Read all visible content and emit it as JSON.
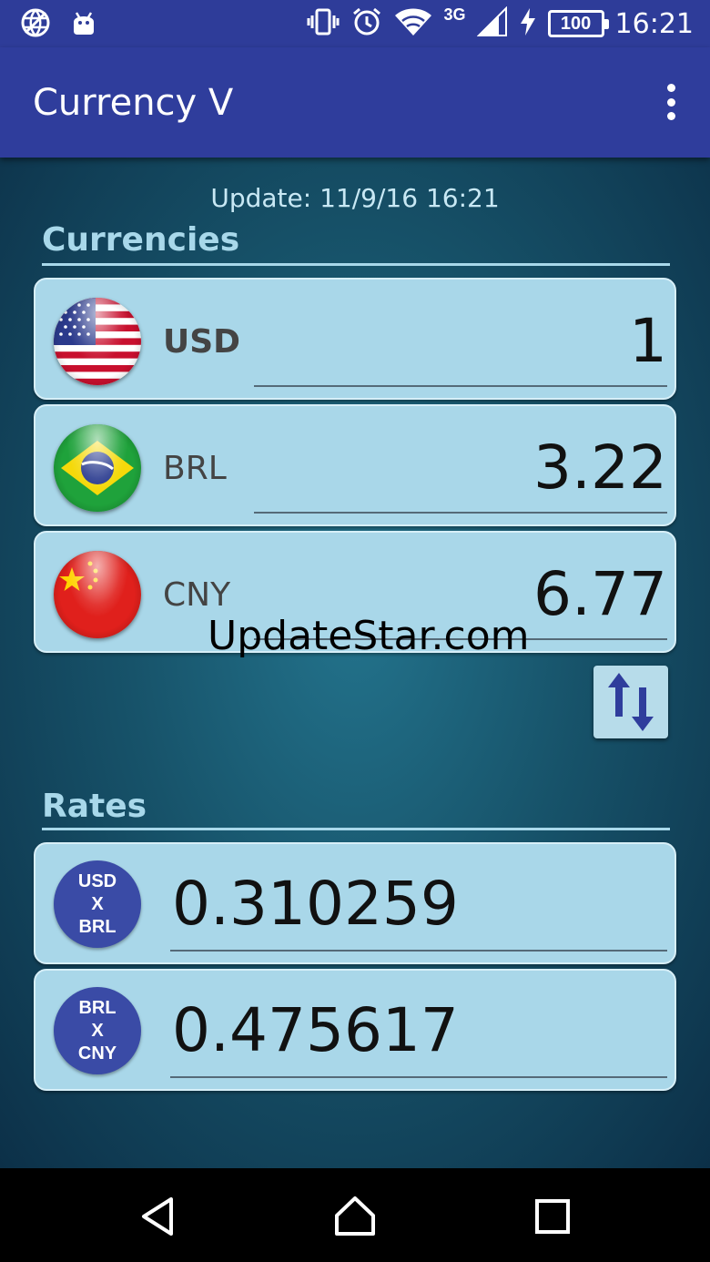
{
  "status_bar": {
    "network_type": "3G",
    "battery": "100",
    "time": "16:21"
  },
  "app_bar": {
    "title": "Currency V"
  },
  "update": {
    "text": "Update: 11/9/16 16:21"
  },
  "currencies": {
    "title": "Currencies",
    "items": [
      {
        "code": "USD",
        "value": "1",
        "flag": "us-flag-icon"
      },
      {
        "code": "BRL",
        "value": "3.22",
        "flag": "brazil-flag-icon"
      },
      {
        "code": "CNY",
        "value": "6.77",
        "flag": "china-flag-icon"
      }
    ]
  },
  "watermark": "UpdateStar.com",
  "rates": {
    "title": "Rates",
    "items": [
      {
        "from": "USD",
        "sep": "X",
        "to": "BRL",
        "value": "0.310259"
      },
      {
        "from": "BRL",
        "sep": "X",
        "to": "CNY",
        "value": "0.475617"
      }
    ]
  },
  "colors": {
    "app_bar": "#2f3d9c",
    "card": "#a9d7e9",
    "badge": "#3a4ba6",
    "section_title": "#a8d8ea"
  }
}
